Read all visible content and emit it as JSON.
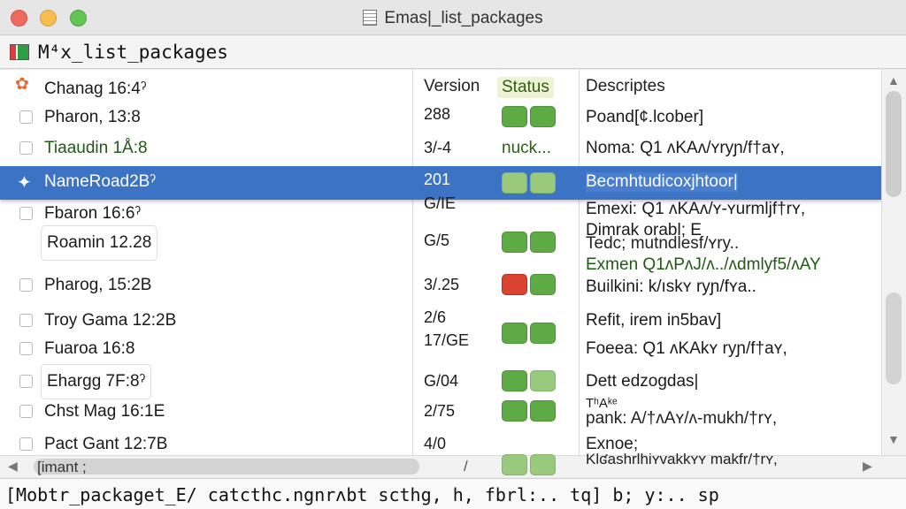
{
  "window": {
    "title": "Emas|_list_packages",
    "buffer_name": "M⁴x_list_packages"
  },
  "columns": {
    "version": "Version",
    "status": "Status",
    "description": "Descriptes"
  },
  "rows": [
    {
      "name": "Chanag 16:4ˀ",
      "version": "",
      "desc": ""
    },
    {
      "name": "Pharon, 13:8",
      "version": "288",
      "desc": "Poand[¢.lcober]"
    },
    {
      "name": "Tiaaudin 1Å:8",
      "version": "3/-4",
      "status_text": "nuck...",
      "desc": "Noma: Q1 ʌKAʌ/ʏryɲ/f†aʏ,"
    },
    {
      "name": "NameRoad2Bˀ",
      "version": "201",
      "desc": "Becmhtudicoxjhtoor|"
    },
    {
      "name": "Fbaron  16:6ˀ",
      "version": "G/IE",
      "desc": "Emexi: Q1 ʌKAʌ/ʏ-ʏurmljf†rʏ,"
    },
    {
      "name": "Roamin 12.28",
      "version": "G/5",
      "desc": "Dimrak orabl; E"
    },
    {
      "name": "Pharog, 15:2B",
      "version": "3/.25",
      "desc": "Builkini: k/ıskʏ ryɲ/fʏa.."
    },
    {
      "name": "Troy Gama 12:2B",
      "version": "2/6",
      "desc": "Refit, irem in5bav]"
    },
    {
      "name": "Fuaroa  16:8",
      "version": "17/GE",
      "desc": "Foeea: Q1 ʌKAkʏ ryɲ/f†aʏ,"
    },
    {
      "name": "Ehargg 7F:8ˀ",
      "version": "G/04",
      "desc": "Dett edzogdas|"
    },
    {
      "name": "Chst Mag 16:1E",
      "version": "2/75",
      "desc": "TʰAᵏᵉ"
    },
    {
      "name": "Pact Gant 12:7B",
      "version": "4/0",
      "desc": "Exnoe;"
    }
  ],
  "extra_desc": {
    "line_a": "Tedc; mutndlesf/ʏry..",
    "line_b": "Exmen Q1ʌPʌJ/ʌ../ʌdmlyf5/ʌAY",
    "line_c": "pank: A/†ʌAʏ/ʌ-mukh/†rʏ,",
    "line_d": "Klʛashrlhiʏvakkʏʏ makfr/†rʏ,"
  },
  "hscroll": {
    "field_text": "[imant ;",
    "slash": "/"
  },
  "minibuffer": {
    "text": "[Mobtr_packaget_E/ catcthc.ngnrʌbt scthg,  h, fbrl:.. tq]  b; y:.. sp"
  },
  "colors": {
    "selection": "#3d73c4",
    "status_green": "#5eaa45",
    "status_light_green": "#98c97c",
    "status_red": "#d9432f"
  }
}
